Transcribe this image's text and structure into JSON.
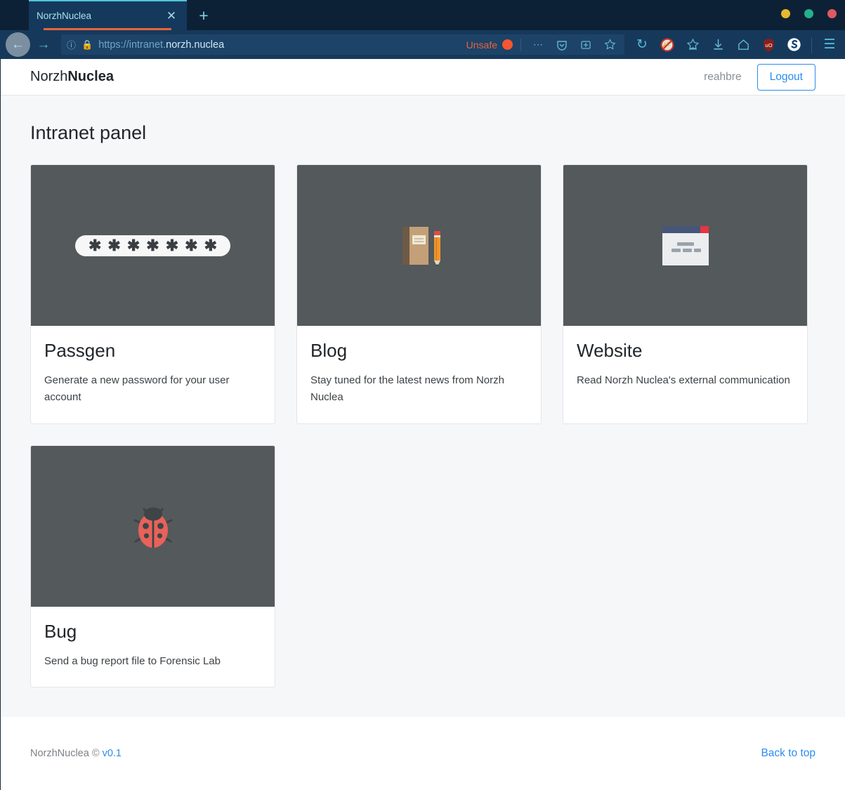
{
  "browser": {
    "tab": {
      "title": "NorzhNuclea",
      "close_icon": "close-icon"
    },
    "new_tab_icon": "plus-icon",
    "window_controls": [
      {
        "name": "minimize",
        "color": "#e8b930"
      },
      {
        "name": "maximize",
        "color": "#23b18c"
      },
      {
        "name": "close",
        "color": "#e05a63"
      }
    ],
    "nav": {
      "back_icon": "arrow-left-icon",
      "forward_icon": "arrow-right-icon",
      "reload_icon": "reload-icon",
      "home_icon": "home-icon",
      "downloads_icon": "download-icon",
      "pocket_icon": "pocket-icon",
      "screenshot_icon": "screenshot-icon",
      "bookmark_icon": "star-icon",
      "menu_icon": "hamburger-menu-icon",
      "extensions": [
        {
          "name": "noscript-icon",
          "label": "S"
        },
        {
          "name": "ublock-origin-icon",
          "label": "uO"
        },
        {
          "name": "sync-icon",
          "label": "S"
        }
      ]
    },
    "url": {
      "info_icon": "info-icon",
      "lock_icon": "padlock-icon",
      "scheme": "https://intranet.",
      "domain": "norzh.nuclea",
      "full": "https://intranet.norzh.nuclea",
      "security_label": "Unsafe",
      "ellipsis_icon": "ellipsis-icon"
    }
  },
  "header": {
    "brand_light": "Norzh",
    "brand_bold": "Nuclea",
    "username": "reahbre",
    "logout_label": "Logout"
  },
  "main": {
    "title": "Intranet panel",
    "cards": [
      {
        "title": "Passgen",
        "text": "Generate a new password for your user account",
        "icon": "password-asterisks-icon",
        "asterisks": "*******"
      },
      {
        "title": "Blog",
        "text": "Stay tuned for the latest news from Norzh Nuclea",
        "icon": "notebook-and-pencil-icon"
      },
      {
        "title": "Website",
        "text": "Read Norzh Nuclea's external communication",
        "icon": "browser-window-icon"
      },
      {
        "title": "Bug",
        "text": "Send a bug report file to Forensic Lab",
        "icon": "ladybug-icon"
      }
    ]
  },
  "footer": {
    "copyright": "NorzhNuclea ©",
    "version": "v0.1",
    "back_to_top": "Back to top"
  },
  "colors": {
    "accent_blue": "#2b8cf0",
    "card_image_bg": "#54595c",
    "page_bg": "#f6f7f9",
    "chrome_bg": "#0d2136",
    "unsafe": "#e8643c"
  }
}
